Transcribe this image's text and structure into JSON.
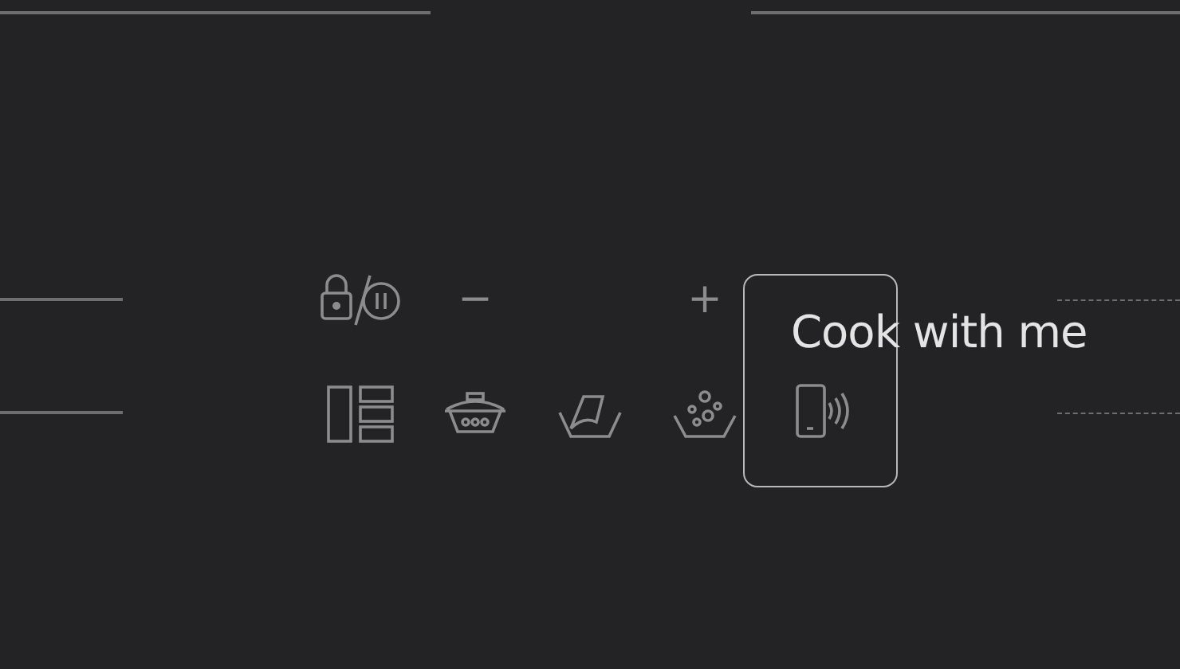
{
  "adjust": {
    "minus": "−",
    "plus": "+"
  },
  "functions": [
    {
      "kind": "layout",
      "selected": false
    },
    {
      "kind": "pot",
      "selected": false
    },
    {
      "kind": "pan",
      "selected": false
    },
    {
      "kind": "bubbles",
      "selected": false
    },
    {
      "kind": "phone",
      "selected": true,
      "label": "Cook with me"
    }
  ]
}
